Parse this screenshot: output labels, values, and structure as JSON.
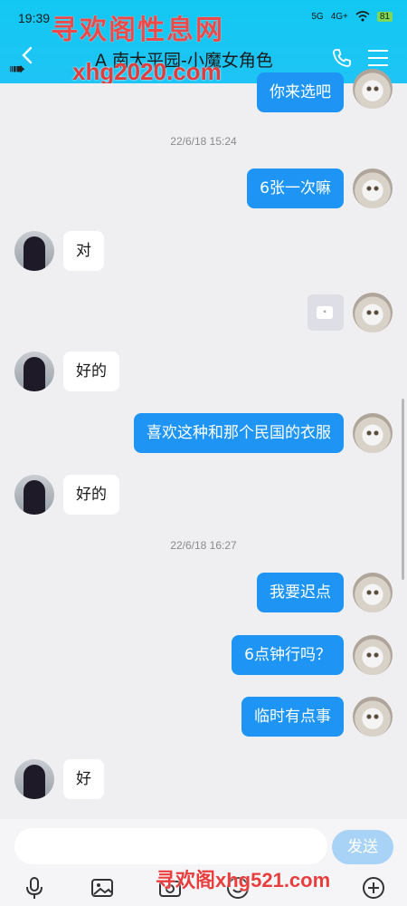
{
  "status_bar": {
    "time": "19:39",
    "net1": "5G",
    "net2": "4G+",
    "battery": "81"
  },
  "watermark": {
    "site_name": "寻欢阁性息网",
    "url_top": "xhg2020.com",
    "url_bottom": "寻欢阁xhg521.com"
  },
  "header": {
    "title": "A 南大平园-小魔女角色"
  },
  "messages": [
    {
      "side": "right",
      "text": "你来选吧"
    },
    {
      "type": "time",
      "text": "22/6/18 15:24"
    },
    {
      "side": "right",
      "text": "6张一次嘛"
    },
    {
      "side": "left",
      "text": "对"
    },
    {
      "side": "right",
      "type": "sticker",
      "text": ""
    },
    {
      "side": "left",
      "text": "好的"
    },
    {
      "side": "right",
      "text": "喜欢这种和那个民国的衣服"
    },
    {
      "side": "left",
      "text": "好的"
    },
    {
      "type": "time",
      "text": "22/6/18 16:27"
    },
    {
      "side": "right",
      "text": "我要迟点"
    },
    {
      "side": "right",
      "text": "6点钟行吗？"
    },
    {
      "side": "right",
      "text": "临时有点事"
    },
    {
      "side": "left",
      "text": "好"
    }
  ],
  "input": {
    "placeholder": "",
    "send_label": "发送"
  },
  "toolbar": {
    "icons": [
      "microphone-icon",
      "image-icon",
      "camera-icon",
      "emoji-icon",
      "add-icon"
    ]
  },
  "colors": {
    "header": "#1ec4f5",
    "bubble_right": "#1e95f5",
    "bubble_left": "#ffffff",
    "send_disabled": "#a9d3f6"
  }
}
